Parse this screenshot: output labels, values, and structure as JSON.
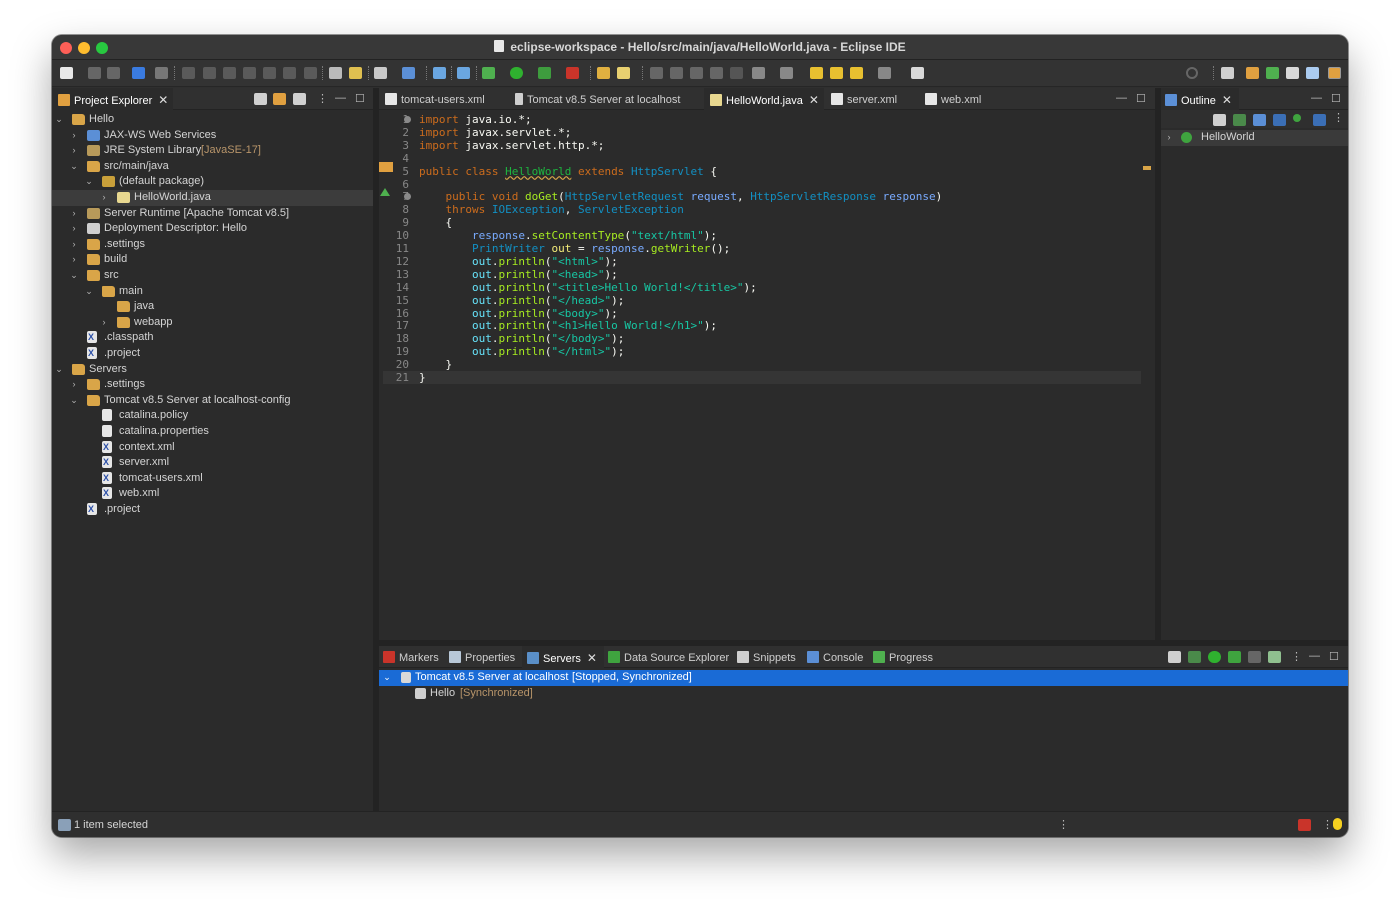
{
  "window": {
    "title": "eclipse-workspace - Hello/src/main/java/HelloWorld.java - Eclipse IDE"
  },
  "project_explorer": {
    "tab_label": "Project Explorer",
    "tree": [
      {
        "label": "Hello",
        "icon": "project-icon",
        "expanded": true
      },
      {
        "label": "JAX-WS Web Services",
        "icon": "webservices-icon"
      },
      {
        "label": "JRE System Library",
        "decoration": "[JavaSE-17]",
        "icon": "library-icon"
      },
      {
        "label": "src/main/java",
        "icon": "source-folder-icon",
        "expanded": true
      },
      {
        "label": "(default package)",
        "icon": "package-icon",
        "expanded": true
      },
      {
        "label": "HelloWorld.java",
        "icon": "java-file-icon",
        "selected": true
      },
      {
        "label": "Server Runtime [Apache Tomcat v8.5]",
        "icon": "library-icon"
      },
      {
        "label": "Deployment Descriptor: Hello",
        "icon": "descriptor-icon"
      },
      {
        "label": ".settings",
        "icon": "folder-icon"
      },
      {
        "label": "build",
        "icon": "folder-icon"
      },
      {
        "label": "src",
        "icon": "folder-icon",
        "expanded": true
      },
      {
        "label": "main",
        "icon": "folder-icon",
        "expanded": true
      },
      {
        "label": "java",
        "icon": "folder-icon"
      },
      {
        "label": "webapp",
        "icon": "folder-icon"
      },
      {
        "label": ".classpath",
        "icon": "xml-file-icon"
      },
      {
        "label": ".project",
        "icon": "xml-file-icon"
      },
      {
        "label": "Servers",
        "icon": "folder-icon",
        "expanded": true
      },
      {
        "label": ".settings",
        "icon": "folder-icon"
      },
      {
        "label": "Tomcat v8.5 Server at localhost-config",
        "icon": "folder-icon",
        "expanded": true
      },
      {
        "label": "catalina.policy",
        "icon": "file-icon"
      },
      {
        "label": "catalina.properties",
        "icon": "file-icon"
      },
      {
        "label": "context.xml",
        "icon": "xml-file-icon"
      },
      {
        "label": "server.xml",
        "icon": "xml-file-icon"
      },
      {
        "label": "tomcat-users.xml",
        "icon": "xml-file-icon"
      },
      {
        "label": "web.xml",
        "icon": "xml-file-icon"
      },
      {
        "label": ".project",
        "icon": "xml-file-icon"
      }
    ]
  },
  "editor": {
    "tabs": [
      {
        "label": "tomcat-users.xml",
        "icon": "xml-file-icon"
      },
      {
        "label": "Tomcat v8.5 Server at localhost",
        "icon": "server-icon"
      },
      {
        "label": "HelloWorld.java",
        "icon": "java-file-icon",
        "active": true
      },
      {
        "label": "server.xml",
        "icon": "xml-file-icon"
      },
      {
        "label": "web.xml",
        "icon": "xml-file-icon"
      }
    ],
    "line_numbers": [
      "1",
      "2",
      "3",
      "4",
      "5",
      "6",
      "7",
      "8",
      "9",
      "10",
      "11",
      "12",
      "13",
      "14",
      "15",
      "16",
      "17",
      "18",
      "19",
      "20",
      "21"
    ],
    "code": {
      "l1": "import java.io.*;",
      "l2": "import javax.servlet.*;",
      "l3": "import javax.servlet.http.*;",
      "l5_kw": "public class ",
      "l5_name": "HelloWorld",
      "l5_ext": " extends ",
      "l5_super": "HttpServlet",
      "l5_brace": " {",
      "l7_kw": "public void ",
      "l7_method": "doGet",
      "l7_p1t": "HttpServletRequest",
      "l7_p1": "request",
      "l7_p2t": "HttpServletResponse",
      "l7_p2": "response",
      "l8_kw": "throws ",
      "l8_e1": "IOException",
      "l8_e2": "ServletException",
      "l9": "{",
      "l10_obj": "response",
      "l10_m": "setContentType",
      "l10_s": "\"text/html\"",
      "l11_t": "PrintWriter",
      "l11_v": "out",
      "l11_obj": "response",
      "l11_m": "getWriter",
      "print_obj": "out",
      "print_m": "println",
      "l12_s": "\"<html>\"",
      "l13_s": "\"<head>\"",
      "l14_s": "\"<title>Hello World!</title>\"",
      "l15_s": "\"</head>\"",
      "l16_s": "\"<body>\"",
      "l17_s": "\"<h1>Hello World!</h1>\"",
      "l18_s": "\"</body>\"",
      "l19_s": "\"</html>\"",
      "l20": "}",
      "l21": "}"
    }
  },
  "outline": {
    "tab_label": "Outline",
    "items": [
      {
        "label": "HelloWorld",
        "icon": "class-icon"
      }
    ]
  },
  "bottom_panel": {
    "tabs": [
      {
        "label": "Markers",
        "icon": "markers-icon"
      },
      {
        "label": "Properties",
        "icon": "properties-icon"
      },
      {
        "label": "Servers",
        "icon": "servers-icon",
        "active": true
      },
      {
        "label": "Data Source Explorer",
        "icon": "datasource-icon"
      },
      {
        "label": "Snippets",
        "icon": "snippets-icon"
      },
      {
        "label": "Console",
        "icon": "console-icon"
      },
      {
        "label": "Progress",
        "icon": "progress-icon"
      }
    ],
    "servers": [
      {
        "label": "Tomcat v8.5 Server at localhost",
        "state": "[Stopped, Synchronized]",
        "selected": true
      },
      {
        "label": "Hello",
        "state": "[Synchronized]"
      }
    ]
  },
  "status_bar": {
    "text": "1 item selected"
  },
  "colors": {
    "selection": "#1a6bd6",
    "keyword": "#cc6c1d",
    "string": "#17c6a3",
    "type": "#1290c3",
    "folder": "#d9a548"
  }
}
